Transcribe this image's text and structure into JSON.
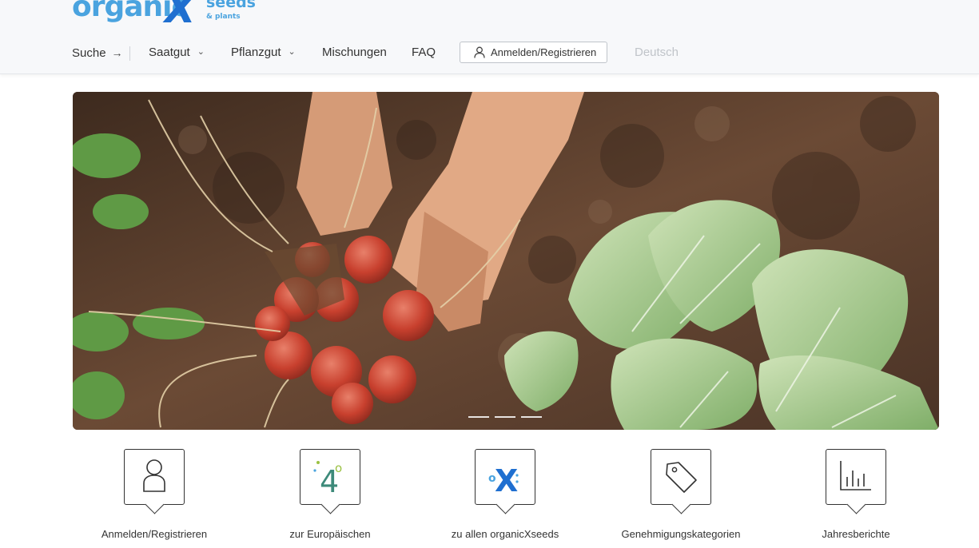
{
  "brand": {
    "word": "organic",
    "x": "X",
    "seeds": "seeds",
    "plants": "& plants"
  },
  "nav": {
    "search_label": "Suche",
    "search_arrow": "→",
    "items": [
      {
        "label": "Saatgut",
        "chevron": "⌄"
      },
      {
        "label": "Pflanzgut",
        "chevron": "⌄"
      },
      {
        "label": "Mischungen"
      },
      {
        "label": "FAQ"
      }
    ],
    "login_label": "Anmelden/Registrieren",
    "language": "Deutsch"
  },
  "hero": {
    "slides": 3,
    "active_slide": 1
  },
  "tiles": [
    {
      "label": "Anmelden/Registrieren",
      "icon": "user-icon"
    },
    {
      "label": "zur Europäischen",
      "icon": "eu-40-icon",
      "icon_text": "4",
      "icon_sub": "o"
    },
    {
      "label": "zu allen organicXseeds",
      "icon": "organicxseeds-icon",
      "icon_text": "X",
      "icon_sub": "o"
    },
    {
      "label": "Genehmigungskategorien",
      "icon": "tag-icon"
    },
    {
      "label": "Jahresberichte",
      "icon": "bar-chart-icon"
    }
  ],
  "colors": {
    "brand_light": "#4aa3df",
    "brand_dark": "#1f6fd0",
    "header_bg": "#f7f8fa"
  }
}
